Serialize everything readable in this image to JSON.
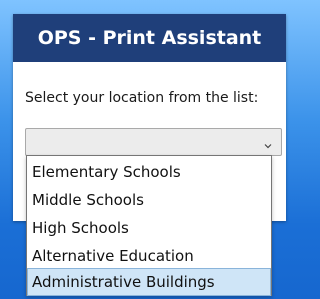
{
  "app": {
    "title": "OPS - Print Assistant"
  },
  "location": {
    "prompt": "Select your location from the list:",
    "selected_value": "",
    "options": [
      "Elementary Schools",
      "Middle Schools",
      "High Schools",
      "Alternative Education",
      "Administrative Buildings"
    ],
    "highlighted_option": "Administrative Buildings"
  },
  "colors": {
    "header_bg": "#1f3f7a",
    "header_text": "#ffffff",
    "highlight_bg": "#cfe5f7"
  },
  "icons": {
    "dropdown": "chevron-down-icon"
  }
}
